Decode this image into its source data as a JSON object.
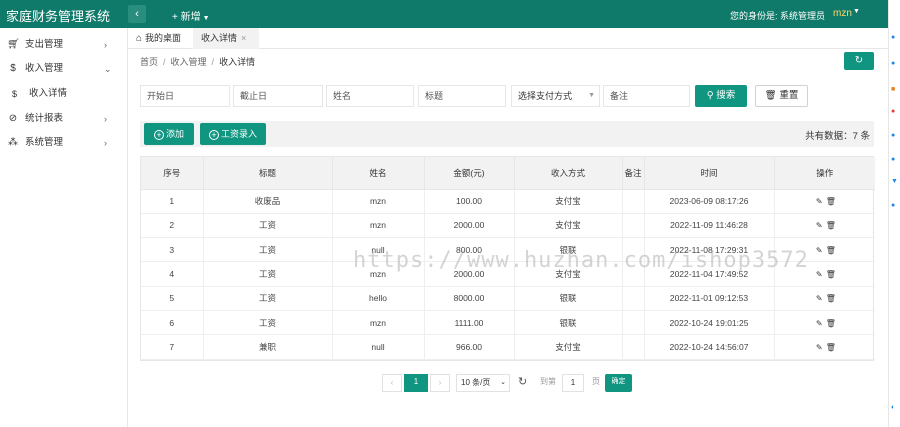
{
  "header": {
    "app_title": "家庭财务管理系统",
    "collapse_icon": "‹",
    "add_new_label": "+ 新增",
    "identity_label": "您的身份是: 系统管理员",
    "username": "mzn"
  },
  "sidebar": {
    "items": [
      {
        "icon": "cart-icon",
        "label": "支出管理"
      },
      {
        "icon": "dollar-icon",
        "label": "收入管理"
      },
      {
        "icon": "dollar-icon",
        "label": "收入详情"
      },
      {
        "icon": "chart-icon",
        "label": "统计报表"
      },
      {
        "icon": "grid-icon",
        "label": "系统管理"
      }
    ]
  },
  "tabs": {
    "home_label": "我的桌面",
    "active_label": "收入详情"
  },
  "breadcrumb": [
    "首页",
    "收入管理",
    "收入详情"
  ],
  "filters": {
    "start_date": "开始日",
    "end_date": "截止日",
    "name": "姓名",
    "title": "标题",
    "payment_method": "选择支付方式",
    "note": "备注",
    "search_label": "搜索",
    "reset_label": "重置"
  },
  "toolbar": {
    "add_label": "添加",
    "salary_label": "工资录入",
    "total_label": "共有数据：7 条"
  },
  "table": {
    "headers": [
      "序号",
      "标题",
      "姓名",
      "金额(元)",
      "收入方式",
      "备注",
      "时间",
      "操作"
    ],
    "rows": [
      [
        "1",
        "收废品",
        "mzn",
        "100.00",
        "支付宝",
        "",
        "2023-06-09 08:17:26"
      ],
      [
        "2",
        "工资",
        "mzn",
        "2000.00",
        "支付宝",
        "",
        "2022-11-09 11:46:28"
      ],
      [
        "3",
        "工资",
        "null",
        "800.00",
        "银联",
        "",
        "2022-11-08 17:29:31"
      ],
      [
        "4",
        "工资",
        "mzn",
        "2000.00",
        "支付宝",
        "",
        "2022-11-04 17:49:52"
      ],
      [
        "5",
        "工资",
        "hello",
        "8000.00",
        "银联",
        "",
        "2022-11-01 09:12:53"
      ],
      [
        "6",
        "工资",
        "mzn",
        "1111.00",
        "银联",
        "",
        "2022-10-24 19:01:25"
      ],
      [
        "7",
        "兼职",
        "null",
        "966.00",
        "支付宝",
        "",
        "2022-10-24 14:56:07"
      ]
    ]
  },
  "pagination": {
    "prev": "‹",
    "current_page": "1",
    "next": "›",
    "page_size": "10 条/页",
    "goto_label": "到第",
    "goto_value": "1",
    "page_unit": "页",
    "confirm_label": "确定"
  },
  "watermark": "https://www.huzhan.com/ishop3572",
  "colors": {
    "topbar": "#0f7a6a",
    "primary_button": "#0f9580",
    "username": "#ffd966"
  }
}
